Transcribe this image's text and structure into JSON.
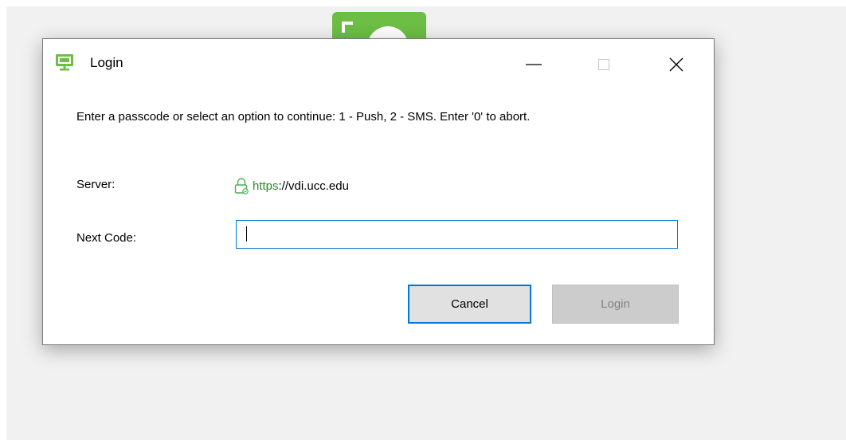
{
  "dialog": {
    "title": "Login",
    "message": "Enter a passcode or select an option to continue: 1 - Push, 2 - SMS. Enter '0' to abort.",
    "server_label": "Server:",
    "server_url_scheme": "https",
    "server_url_rest": "://vdi.ucc.edu",
    "next_code_label": "Next Code:",
    "next_code_value": "",
    "cancel_label": "Cancel",
    "login_label": "Login",
    "login_enabled": false
  },
  "titlebar": {
    "app_icon": "remote-desktop-monitor-icon",
    "controls": [
      "minimize-icon",
      "maximize-icon",
      "close-icon"
    ]
  },
  "colors": {
    "accent": "#0078d7",
    "brand_green": "#6cbe45",
    "secure_url_green": "#2a8a2a",
    "desktop_background": "#f1f1f1"
  }
}
